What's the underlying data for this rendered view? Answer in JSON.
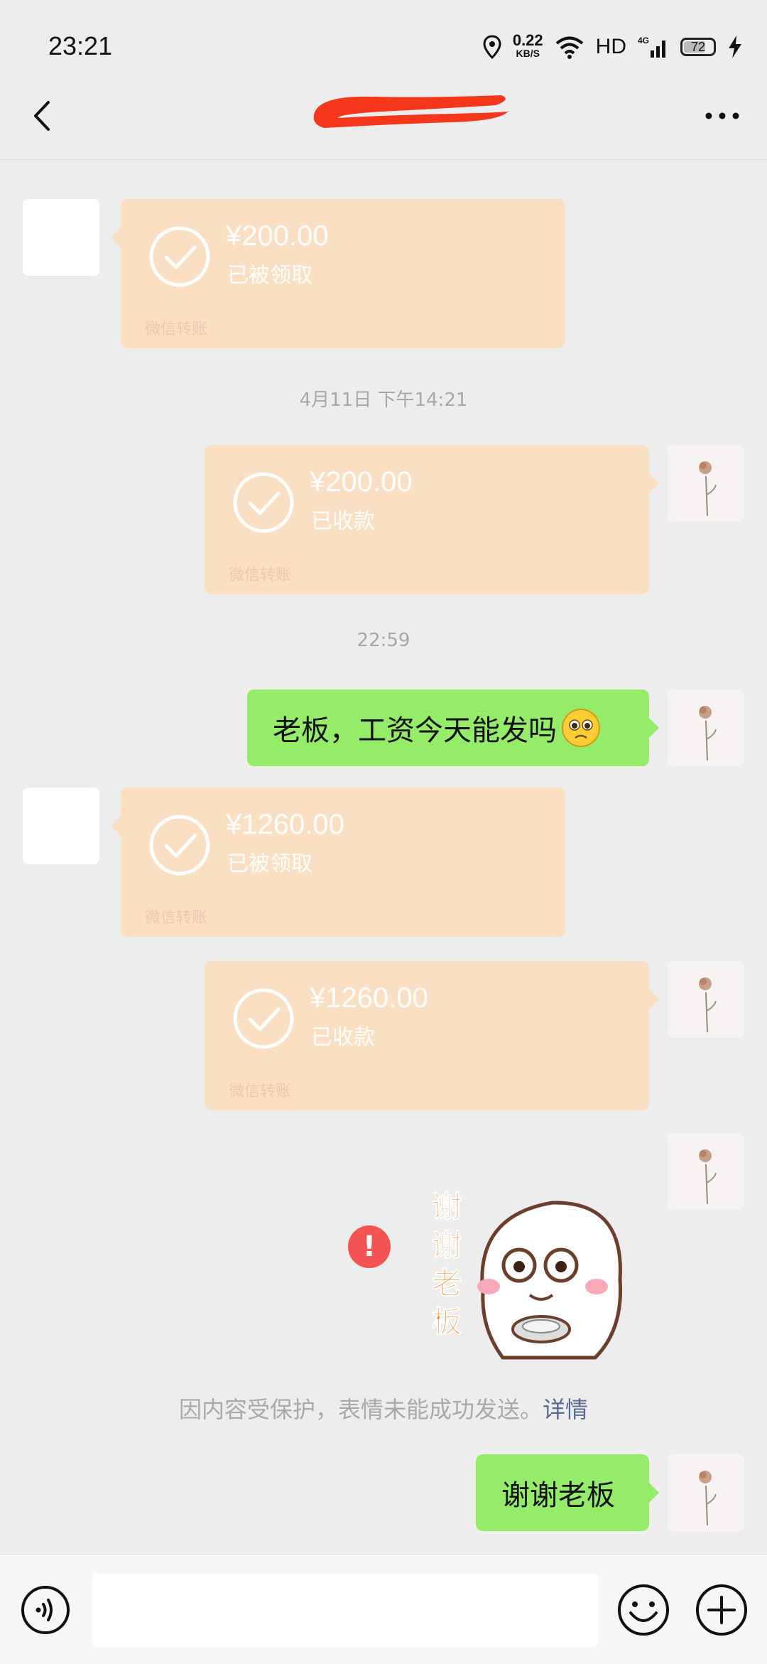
{
  "status_bar": {
    "time": "23:21",
    "net_speed_value": "0.22",
    "net_speed_unit": "KB/S",
    "hd": "HD",
    "signal": "4G",
    "battery": "72"
  },
  "colors": {
    "transfer_card": "#fbdfc3",
    "sent_bubble": "#95ec69",
    "background": "#ededed",
    "error_badge": "#f25454",
    "link": "#576b95"
  },
  "messages": [
    {
      "kind": "transfer",
      "side": "left",
      "amount": "¥200.00",
      "status": "已被领取",
      "brand": "微信转账"
    },
    {
      "kind": "timestamp",
      "text": "4月11日 下午14:21"
    },
    {
      "kind": "transfer",
      "side": "right",
      "amount": "¥200.00",
      "status": "已收款",
      "brand": "微信转账"
    },
    {
      "kind": "timestamp",
      "text": "22:59"
    },
    {
      "kind": "text",
      "side": "right",
      "text": "老板，工资今天能发吗",
      "emoji": "pleading-face-emoji"
    },
    {
      "kind": "transfer",
      "side": "left",
      "amount": "¥1260.00",
      "status": "已被领取",
      "brand": "微信转账"
    },
    {
      "kind": "transfer",
      "side": "right",
      "amount": "¥1260.00",
      "status": "已收款",
      "brand": "微信转账"
    },
    {
      "kind": "sticker",
      "side": "right",
      "sticker_text": "谢谢老板",
      "failed": true
    },
    {
      "kind": "system",
      "text": "因内容受保护，表情未能成功发送。",
      "link": "详情"
    },
    {
      "kind": "text",
      "side": "right",
      "text": "谢谢老板"
    }
  ]
}
